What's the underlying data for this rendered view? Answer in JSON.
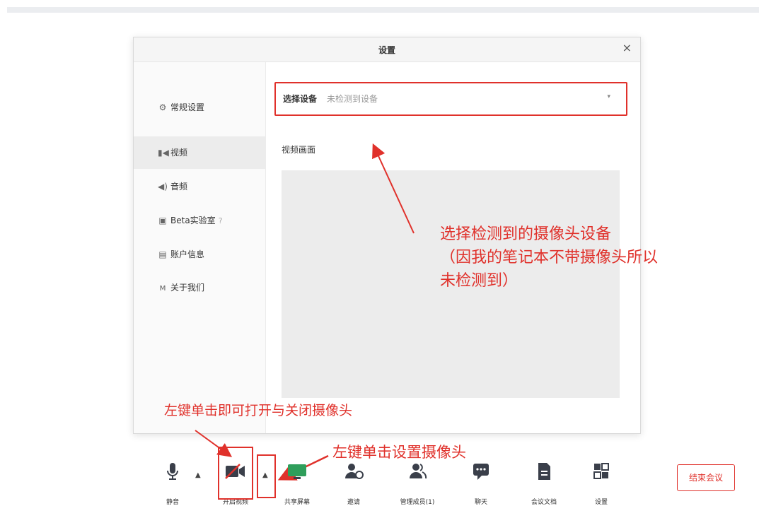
{
  "dialog": {
    "title": "设置",
    "close": "×"
  },
  "sidebar": {
    "items": [
      {
        "label": "常规设置",
        "icon": "gear-icon",
        "glyph": "⚙"
      },
      {
        "label": "视频",
        "icon": "video-icon",
        "glyph": "▮◀"
      },
      {
        "label": "音频",
        "icon": "speaker-icon",
        "glyph": "◀)"
      },
      {
        "label": "Beta实验室",
        "icon": "lab-icon",
        "glyph": "▣",
        "help": "?"
      },
      {
        "label": "账户信息",
        "icon": "id-card-icon",
        "glyph": "▤"
      },
      {
        "label": "关于我们",
        "icon": "about-icon",
        "glyph": "ᴍ"
      }
    ],
    "active_index": 1
  },
  "device": {
    "label": "选择设备",
    "value": "未检测到设备",
    "caret": "▾"
  },
  "preview": {
    "label": "视频画面"
  },
  "annotations": {
    "camera_note_line1": "选择检测到的摄像头设备",
    "camera_note_line2": "（因我的笔记本不带摄像头所以",
    "camera_note_line3": "未检测到）",
    "left_click_toggle": "左键单击即可打开与关闭摄像头",
    "left_click_settings": "左键单击设置摄像头"
  },
  "toolbar": {
    "mute": "静音",
    "video": "开启视频",
    "share": "共享屏幕",
    "invite": "邀请",
    "members": "管理成员(1)",
    "chat": "聊天",
    "docs": "会议文档",
    "settings": "设置",
    "end": "结束会议"
  },
  "colors": {
    "accent_red": "#e0312b",
    "preview_bg": "#ececec",
    "share_green": "#2f9e5b"
  }
}
